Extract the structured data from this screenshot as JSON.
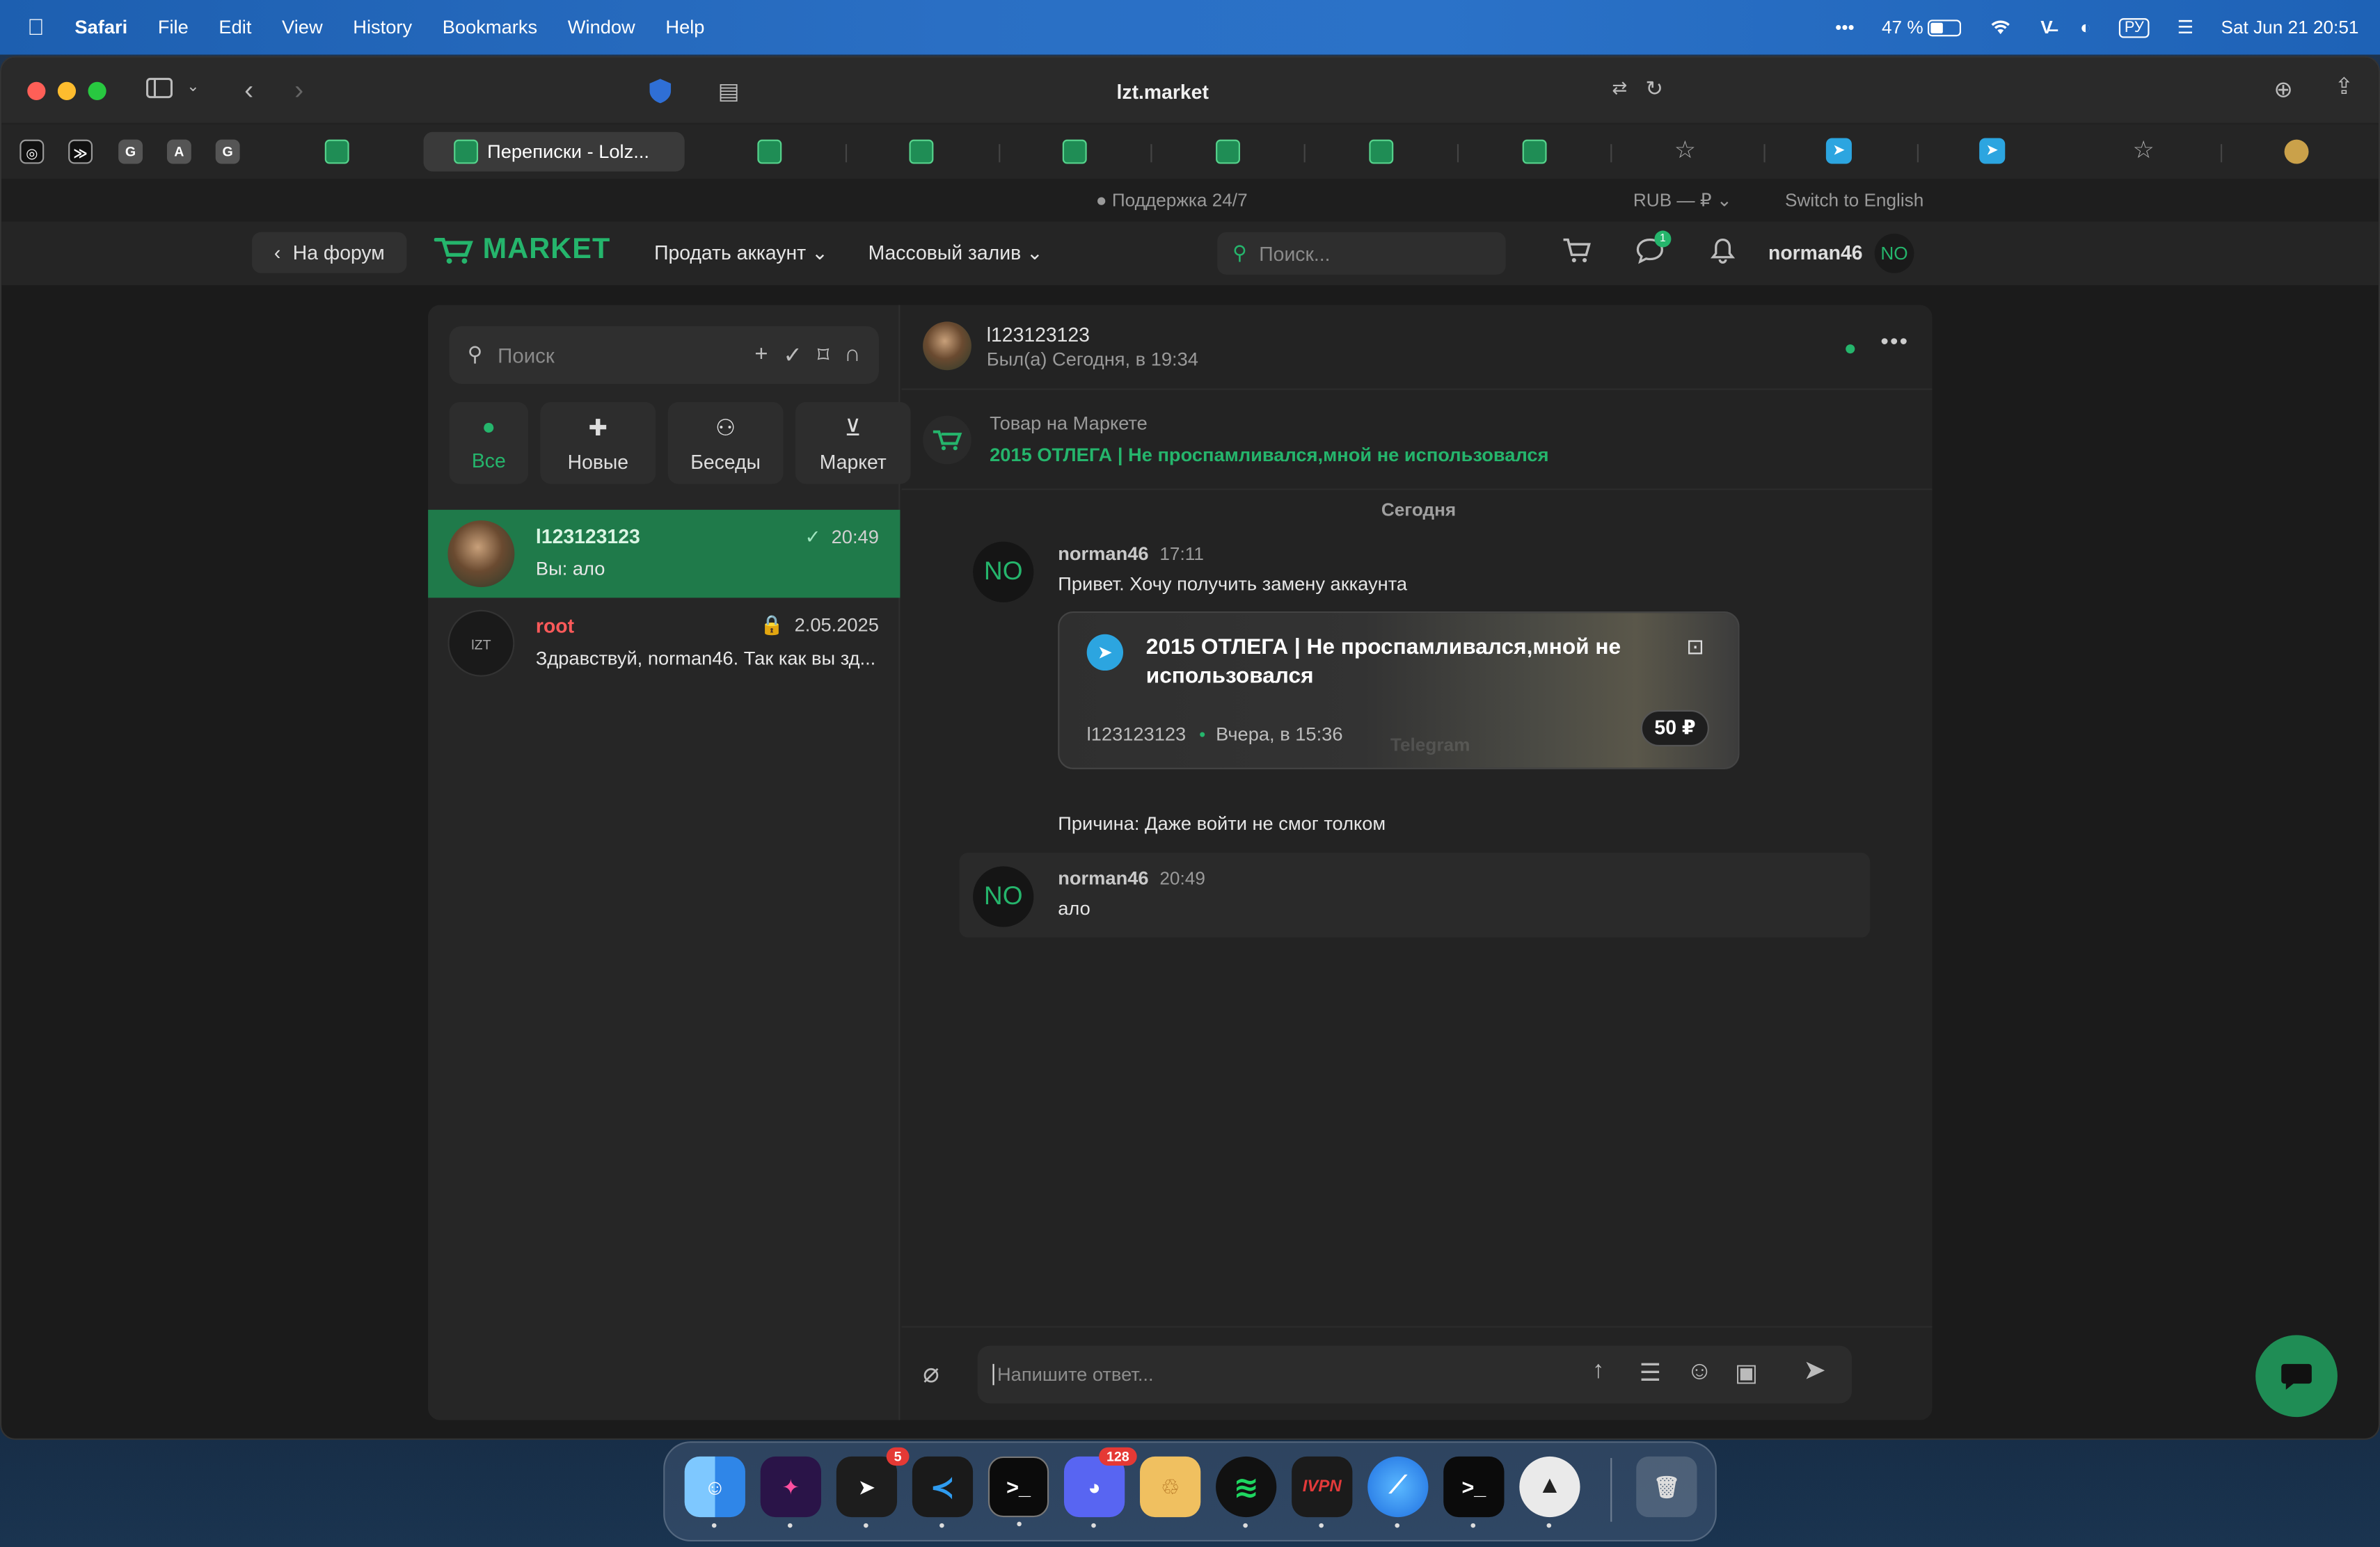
{
  "menubar": {
    "app": "Safari",
    "items": [
      "File",
      "Edit",
      "View",
      "History",
      "Bookmarks",
      "Window",
      "Help"
    ],
    "battery": "47 %",
    "input_source": "РУ",
    "datetime": "Sat Jun 21  20:51"
  },
  "browser": {
    "address": "lzt.market",
    "active_tab": "Переписки - Lolz...",
    "pinned_letters": [
      "G",
      "A",
      "G"
    ]
  },
  "topstrip": {
    "support": "Поддержка 24/7",
    "currency": "RUB — ₽",
    "language": "Switch to English"
  },
  "nav": {
    "back": "На форум",
    "logo": "MARKET",
    "sell": "Продать аккаунт",
    "mass": "Массовый залив",
    "search_placeholder": "Поиск...",
    "messages_badge": "1",
    "username": "norman46",
    "avatar": "NO"
  },
  "sidebar": {
    "search_placeholder": "Поиск",
    "filters": [
      "Все",
      "Новые",
      "Беседы",
      "Маркет"
    ],
    "conversations": [
      {
        "name": "l123123123",
        "time": "20:49",
        "preview": "Вы: ало"
      },
      {
        "name": "root",
        "time": "2.05.2025",
        "preview": "Здравствуй, norman46. Так как вы зд..."
      }
    ]
  },
  "chat": {
    "peer_name": "l123123123",
    "peer_status": "Был(а) Сегодня, в 19:34",
    "product_label": "Товар на Маркете",
    "product_link": "2015 ОТЛЕГА | Не проспамливался,мной не использовался",
    "day_divider": "Сегодня",
    "messages": [
      {
        "avatar": "NO",
        "author": "norman46",
        "time": "17:11",
        "text": "Привет. Хочу получить замену аккаунта"
      },
      {
        "avatar": "NO",
        "author": "norman46",
        "time": "20:49",
        "text": "ало"
      }
    ],
    "card": {
      "title": "2015 ОТЛЕГА | Не проспамливался,мной не использовался",
      "seller": "l123123123",
      "date": "Вчера, в 15:36",
      "price": "50 ₽",
      "watermark": "Telegram"
    },
    "reason": "Причина: Даже войти не смог толком",
    "composer_placeholder": "Напишите ответ..."
  },
  "dock": {
    "telegram_badge": "5",
    "discord_badge": "128",
    "vpn_label": "IVPN",
    "terminal_label": ">_"
  },
  "colors": {
    "accent": "#25b56c",
    "active_conv": "#1f7a4a",
    "menubar": "#2a6fc4",
    "badge": "#e53935"
  }
}
